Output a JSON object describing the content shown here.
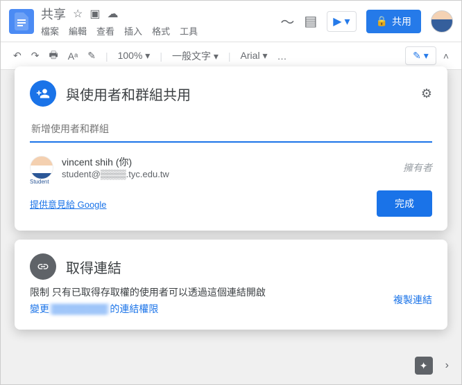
{
  "header": {
    "title": "共享",
    "menus": [
      "檔案",
      "編輯",
      "查看",
      "插入",
      "格式",
      "工具"
    ],
    "share_button": "共用"
  },
  "toolbar": {
    "zoom": "100%",
    "style": "一般文字",
    "font": "Arial"
  },
  "share_dialog": {
    "title": "與使用者和群組共用",
    "placeholder": "新增使用者和群組",
    "user": {
      "name": "vincent shih (你)",
      "email": "student@▒▒▒▒.tyc.edu.tw",
      "avatar_label": "Student"
    },
    "owner_label": "擁有者",
    "feedback": "提供意見給 Google",
    "done": "完成"
  },
  "link_dialog": {
    "title": "取得連結",
    "desc_prefix": "限制",
    "desc": "只有已取得存取權的使用者可以透過這個連結開啟",
    "change_prefix": "變更",
    "change_suffix": "的連結權限",
    "blurred": "▒▒▒▒▒▒▒▒",
    "copy": "複製連結"
  }
}
